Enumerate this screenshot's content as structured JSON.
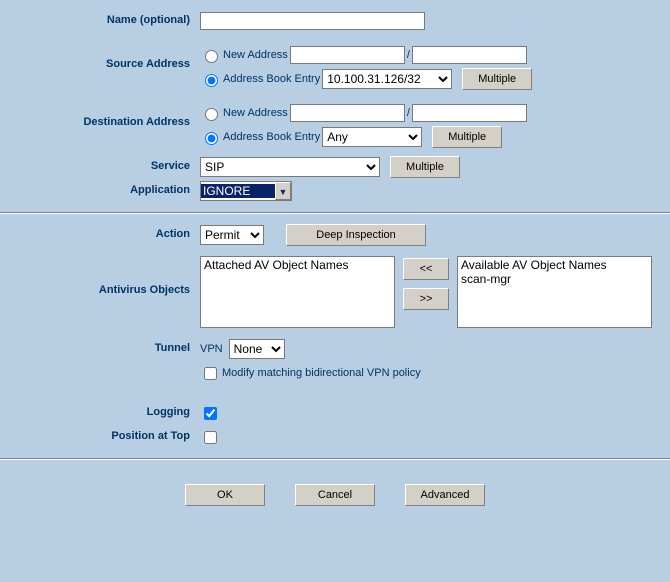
{
  "labels": {
    "name": "Name (optional)",
    "src": "Source Address",
    "dst": "Destination Address",
    "service": "Service",
    "application": "Application",
    "action": "Action",
    "av": "Antivirus Objects",
    "tunnel": "Tunnel",
    "logging": "Logging",
    "position": "Position at Top"
  },
  "name_value": "",
  "src": {
    "new_addr_label": "New Address",
    "new_addr1": "",
    "new_addr2": "",
    "sep": "/",
    "book_label": "Address Book Entry",
    "book_value": "10.100.31.126/32",
    "multiple": "Multiple",
    "selected": "book"
  },
  "dst": {
    "new_addr_label": "New Address",
    "new_addr1": "",
    "new_addr2": "",
    "sep": "/",
    "book_label": "Address Book Entry",
    "book_value": "Any",
    "multiple": "Multiple",
    "selected": "book"
  },
  "service": {
    "value": "SIP",
    "multiple": "Multiple"
  },
  "application": {
    "value": "IGNORE"
  },
  "action": {
    "value": "Permit",
    "deep": "Deep Inspection"
  },
  "av": {
    "attached_header": "Attached AV Object Names",
    "available_header": "Available AV Object Names",
    "available_items": "scan-mgr",
    "move_left": "<<",
    "move_right": ">>"
  },
  "tunnel": {
    "vpn_label": "VPN",
    "vpn_value": "None",
    "modify_label": "Modify matching bidirectional VPN policy",
    "modify_checked": false
  },
  "logging_checked": true,
  "position_checked": false,
  "buttons": {
    "ok": "OK",
    "cancel": "Cancel",
    "advanced": "Advanced"
  }
}
